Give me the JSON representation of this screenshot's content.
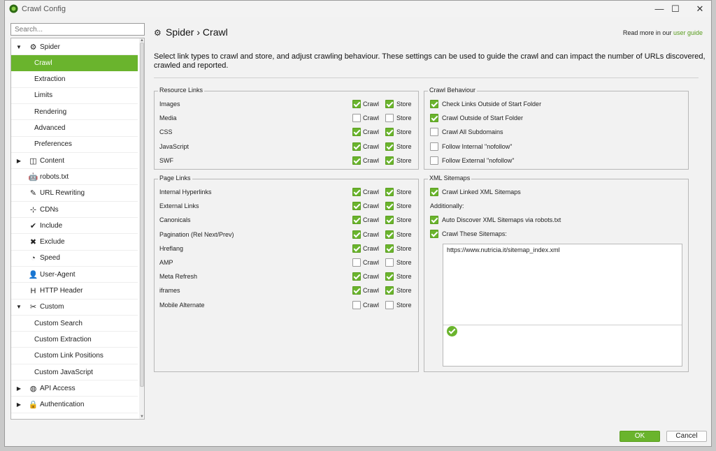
{
  "window": {
    "title": "Crawl Config",
    "minimize_glyph": "—",
    "maximize_glyph": "☐",
    "close_glyph": "✕"
  },
  "colors": {
    "accent": "#6ab42d",
    "accent_dark": "#5a9e1f"
  },
  "search": {
    "placeholder": "Search..."
  },
  "tree": [
    {
      "label": "Spider",
      "icon": "gear-icon",
      "glyph": "⚙",
      "caret": "▼",
      "level": 0
    },
    {
      "label": "Crawl",
      "level": 1,
      "selected": true
    },
    {
      "label": "Extraction",
      "level": 1
    },
    {
      "label": "Limits",
      "level": 1
    },
    {
      "label": "Rendering",
      "level": 1
    },
    {
      "label": "Advanced",
      "level": 1
    },
    {
      "label": "Preferences",
      "level": 1
    },
    {
      "label": "Content",
      "icon": "content-icon",
      "glyph": "◫",
      "caret": "▶",
      "level": 0
    },
    {
      "label": "robots.txt",
      "icon": "robot-icon",
      "glyph": "🤖",
      "level": 0
    },
    {
      "label": "URL Rewriting",
      "icon": "edit-icon",
      "glyph": "✎",
      "level": 0
    },
    {
      "label": "CDNs",
      "icon": "network-icon",
      "glyph": "⊹",
      "level": 0
    },
    {
      "label": "Include",
      "icon": "check-circle-icon",
      "glyph": "✔",
      "level": 0
    },
    {
      "label": "Exclude",
      "icon": "cross-circle-icon",
      "glyph": "✖",
      "level": 0
    },
    {
      "label": "Speed",
      "icon": "speedometer-icon",
      "glyph": "◔",
      "level": 0
    },
    {
      "label": "User-Agent",
      "icon": "user-secret-icon",
      "glyph": "👤",
      "level": 0
    },
    {
      "label": "HTTP Header",
      "icon": "header-icon",
      "glyph": "H",
      "level": 0
    },
    {
      "label": "Custom",
      "icon": "tools-icon",
      "glyph": "✂",
      "caret": "▼",
      "level": 0
    },
    {
      "label": "Custom Search",
      "level": 1
    },
    {
      "label": "Custom Extraction",
      "level": 1
    },
    {
      "label": "Custom Link Positions",
      "level": 1
    },
    {
      "label": "Custom JavaScript",
      "level": 1
    },
    {
      "label": "API Access",
      "icon": "globe-icon",
      "glyph": "◍",
      "caret": "▶",
      "level": 0
    },
    {
      "label": "Authentication",
      "icon": "users-lock-icon",
      "glyph": "🔒",
      "caret": "▶",
      "level": 0
    }
  ],
  "header": {
    "section": "Spider",
    "separator": "›",
    "page": "Crawl",
    "read_more_prefix": "Read more in our",
    "read_more_link": "user guide"
  },
  "intro": "Select link types to crawl and store, and adjust crawling behaviour. These settings can be used to guide the crawl and can impact the number of URLs discovered, crawled and reported.",
  "labels": {
    "crawl": "Crawl",
    "store": "Store"
  },
  "resource_links": {
    "title": "Resource Links",
    "rows": [
      {
        "label": "Images",
        "crawl": true,
        "store": true
      },
      {
        "label": "Media",
        "crawl": false,
        "store": false
      },
      {
        "label": "CSS",
        "crawl": true,
        "store": true
      },
      {
        "label": "JavaScript",
        "crawl": true,
        "store": true
      },
      {
        "label": "SWF",
        "crawl": true,
        "store": true
      }
    ]
  },
  "page_links": {
    "title": "Page Links",
    "rows": [
      {
        "label": "Internal Hyperlinks",
        "crawl": true,
        "store": true
      },
      {
        "label": "External Links",
        "crawl": true,
        "store": true
      },
      {
        "label": "Canonicals",
        "crawl": true,
        "store": true
      },
      {
        "label": "Pagination (Rel Next/Prev)",
        "crawl": true,
        "store": true
      },
      {
        "label": "Hreflang",
        "crawl": true,
        "store": true
      },
      {
        "label": "AMP",
        "crawl": false,
        "store": false
      },
      {
        "label": "Meta Refresh",
        "crawl": true,
        "store": true
      },
      {
        "label": "iframes",
        "crawl": true,
        "store": true
      },
      {
        "label": "Mobile Alternate",
        "crawl": false,
        "store": false
      }
    ]
  },
  "crawl_behaviour": {
    "title": "Crawl Behaviour",
    "rows": [
      {
        "label": "Check Links Outside of Start Folder",
        "checked": true
      },
      {
        "label": "Crawl Outside of Start Folder",
        "checked": true
      },
      {
        "label": "Crawl All Subdomains",
        "checked": false
      },
      {
        "label": "Follow Internal \"nofollow\"",
        "checked": false
      },
      {
        "label": "Follow External \"nofollow\"",
        "checked": false
      }
    ]
  },
  "xml_sitemaps": {
    "title": "XML Sitemaps",
    "crawl_linked": {
      "label": "Crawl Linked XML Sitemaps",
      "checked": true
    },
    "additionally": "Additionally:",
    "auto_discover": {
      "label": "Auto Discover XML Sitemaps via robots.txt",
      "checked": true
    },
    "crawl_these": {
      "label": "Crawl These Sitemaps:",
      "checked": true
    },
    "sitemap_url": "https://www.nutricia.it/sitemap_index.xml"
  },
  "buttons": {
    "ok": "OK",
    "cancel": "Cancel"
  }
}
